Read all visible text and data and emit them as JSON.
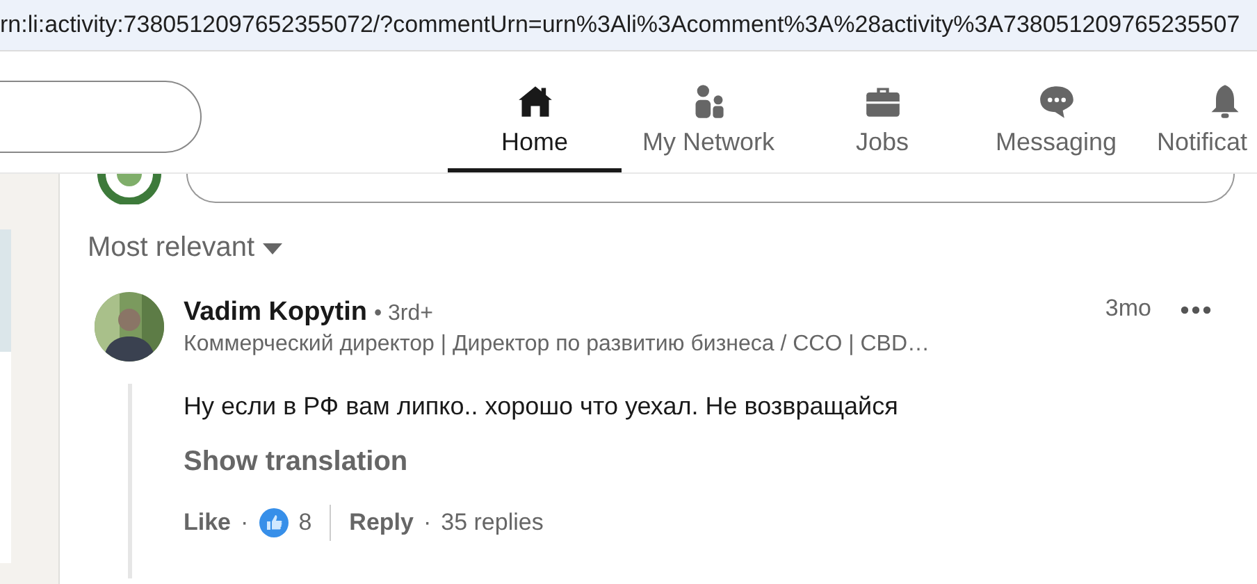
{
  "address_bar": {
    "url": "rn:li:activity:7380512097652355072/?commentUrn=urn%3Ali%3Acomment%3A%28activity%3A738051209765235507"
  },
  "nav": [
    {
      "label": "Home",
      "kind": "home",
      "selected": true
    },
    {
      "label": "My Network",
      "kind": "people",
      "selected": false
    },
    {
      "label": "Jobs",
      "kind": "briefcase",
      "selected": false
    },
    {
      "label": "Messaging",
      "kind": "chat",
      "selected": false
    },
    {
      "label": "Notificat",
      "kind": "bell",
      "selected": false
    }
  ],
  "sort": {
    "label": "Most relevant"
  },
  "comment": {
    "author": "Vadim Kopytin",
    "degree": "• 3rd+",
    "headline": "Коммерческий директор | Директор по развитию бизнеса / CCO | CBD…",
    "time": "3mo",
    "text": "Ну если в РФ вам липко.. хорошо что уехал. Не возвращайся",
    "translate": "Show translation",
    "like": "Like",
    "separator": "·",
    "reaction_count": "8",
    "reply": "Reply",
    "separator_2": "·",
    "replies": "35 replies"
  }
}
